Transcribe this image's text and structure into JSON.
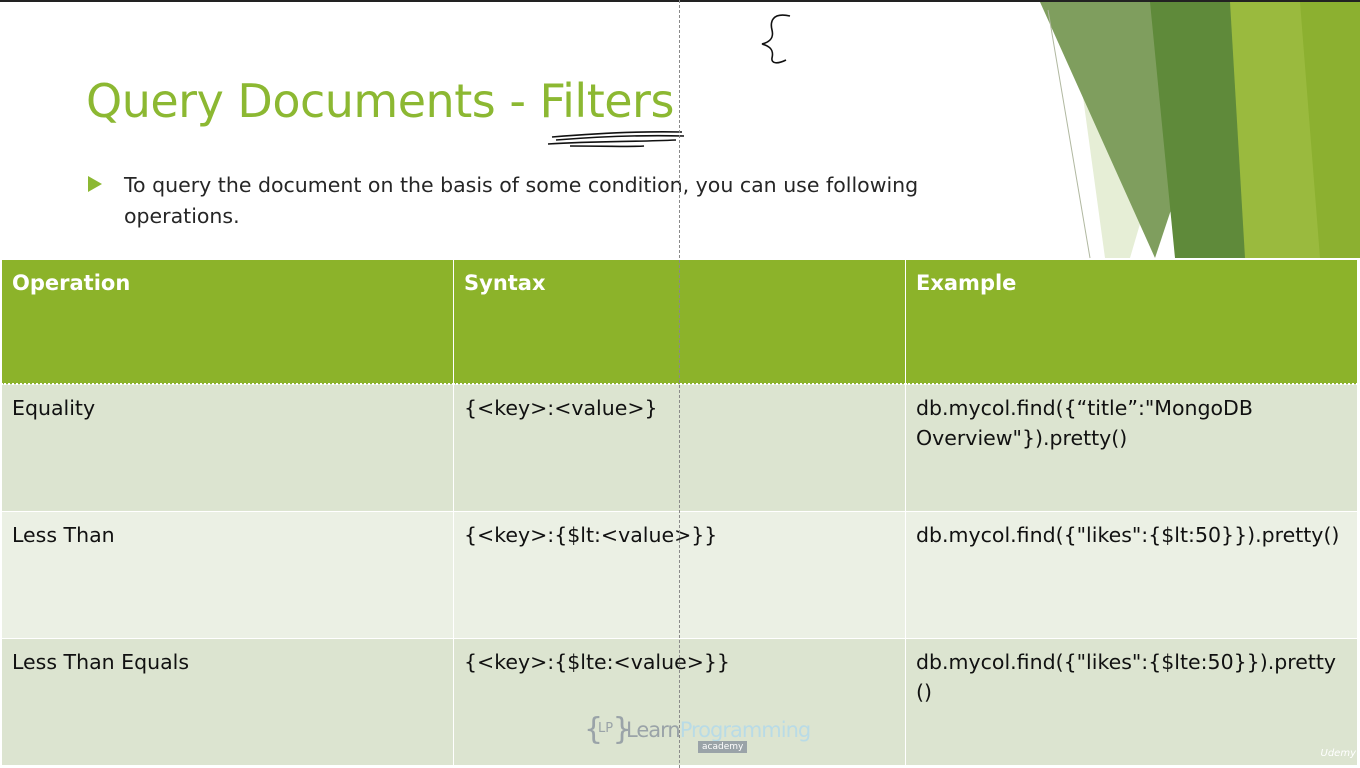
{
  "slide": {
    "title": "Query Documents - Filters",
    "bullet_text": "To query the document on the basis of some condition, you can use following operations."
  },
  "table": {
    "headers": [
      "Operation",
      "Syntax",
      "Example"
    ],
    "rows": [
      {
        "operation": "Equality",
        "syntax": "{<key>:<value>}",
        "example": "db.mycol.find({“title”:\"MongoDB Overview\"}).pretty()"
      },
      {
        "operation": "Less Than",
        "syntax": "{<key>:{$lt:<value>}}",
        "example": "db.mycol.find({\"likes\":{$lt:50}}).pretty()"
      },
      {
        "operation": "Less Than Equals",
        "syntax": "{<key>:{$lte:<value>}}",
        "example": "db.mycol.find({\"likes\":{$lte:50}}).pretty()"
      }
    ]
  },
  "watermark": {
    "brand_initials": "LP",
    "brand_learn": "Learn",
    "brand_programming": "Programming",
    "brand_academy": "academy"
  },
  "udemy_label": "Udemy",
  "colors": {
    "accent": "#8cb832",
    "header_bg": "#8cb32a",
    "row_odd": "#dce4d0",
    "row_even": "#ebf0e4"
  },
  "icons": {
    "bullet": "triangle-right-icon",
    "annotation": "curly-brace-icon"
  }
}
